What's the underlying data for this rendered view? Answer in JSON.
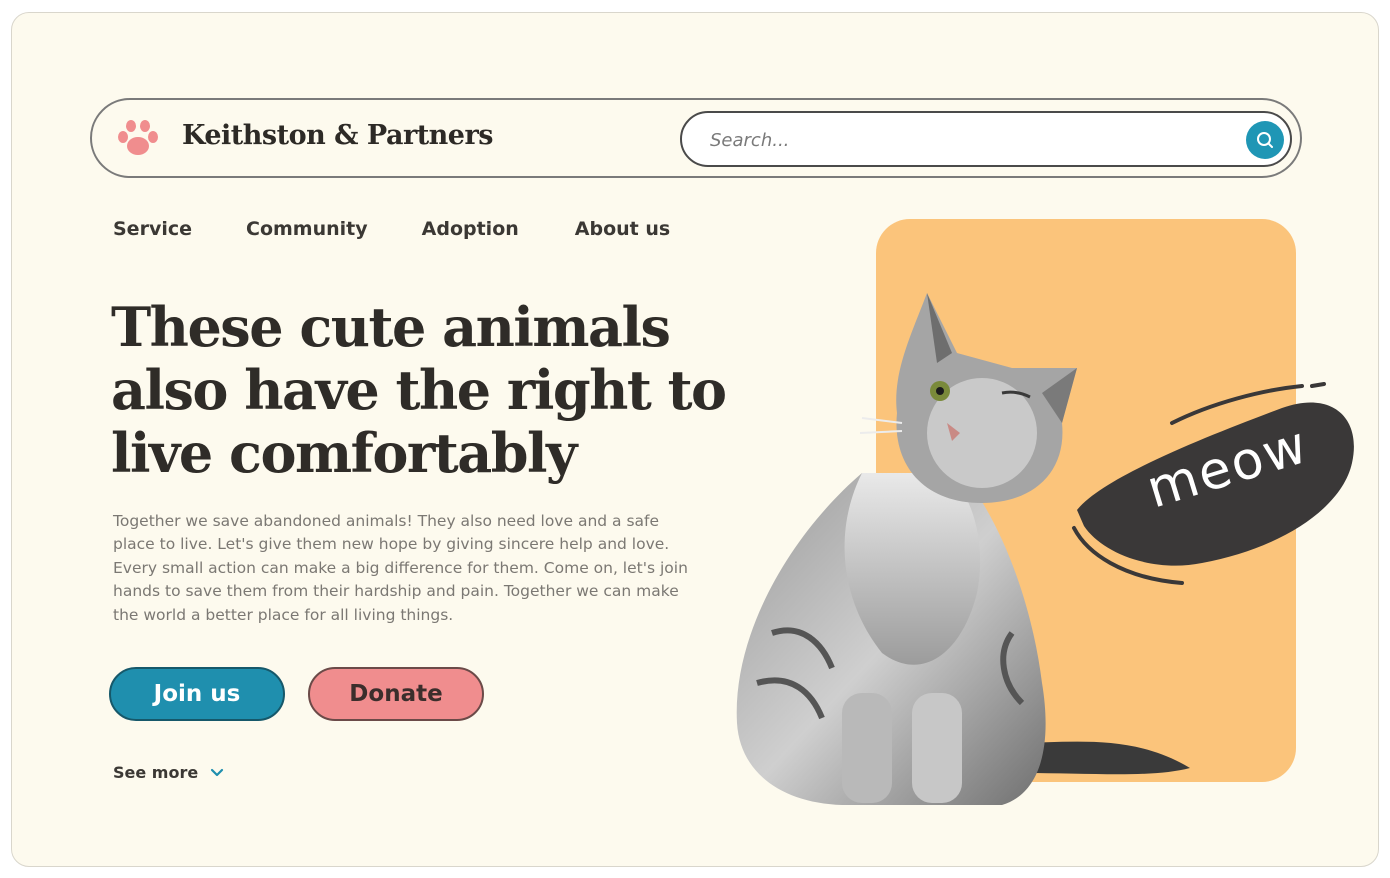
{
  "brand": {
    "name": "Keithston & Partners",
    "logo_icon": "paw-icon"
  },
  "search": {
    "placeholder": "Search...",
    "button_icon": "search-icon"
  },
  "nav": {
    "items": [
      "Service",
      "Community",
      "Adoption",
      "About us"
    ]
  },
  "hero": {
    "headline": "These cute animals also have the right to live comfortably",
    "description": "Together we save abandoned animals! They also need love and a safe place to live. Let's give them new hope by giving sincere help and love. Every small action can make a big difference for them. Come on, let's join hands to save them from their hardship and pain. Together we can make the world a better place for all living things.",
    "join_label": "Join us",
    "donate_label": "Donate",
    "see_more_label": "See more",
    "bubble_text": "meow"
  },
  "colors": {
    "background": "#fdfaee",
    "accent_teal": "#1f8fae",
    "accent_pink": "#f08d8e",
    "card_orange": "#fbc47b",
    "text_dark": "#2f2c28"
  }
}
